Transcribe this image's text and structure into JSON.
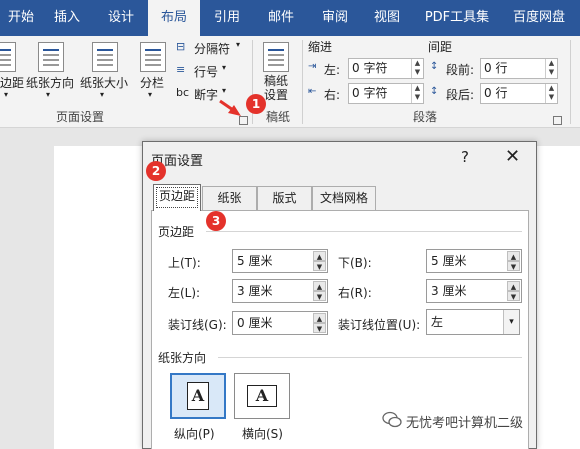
{
  "ribbon_tabs": [
    "开始",
    "插入",
    "设计",
    "布局",
    "引用",
    "邮件",
    "审阅",
    "视图",
    "PDF工具集",
    "百度网盘"
  ],
  "active_tab": "布局",
  "ribbon": {
    "margins_label": "边距",
    "orientation_label": "纸张方向",
    "size_label": "纸张大小",
    "columns_label": "分栏",
    "breaks_label": "分隔符",
    "line_numbers_label": "行号",
    "hyphenation_label": "断字",
    "page_setup_group": "页面设置",
    "draft_paper_label": "稿纸设置",
    "draft_paper_group": "稿纸",
    "indent_label": "缩进",
    "spacing_label": "间距",
    "indent_left_label": "左:",
    "indent_left_value": "0 字符",
    "indent_right_label": "右:",
    "indent_right_value": "0 字符",
    "spacing_before_label": "段前:",
    "spacing_before_value": "0 行",
    "spacing_after_label": "段后:",
    "spacing_after_value": "0 行",
    "paragraph_group": "段落"
  },
  "dialog": {
    "title": "页面设置",
    "help": "?",
    "close": "✕",
    "tabs": [
      "页边距",
      "纸张",
      "版式",
      "文档网格"
    ],
    "margins_section": "页边距",
    "top_label": "上(T):",
    "top_value": "5 厘米",
    "bottom_label": "下(B):",
    "bottom_value": "5 厘米",
    "left_label": "左(L):",
    "left_value": "3 厘米",
    "right_label": "右(R):",
    "right_value": "3 厘米",
    "gutter_label": "装订线(G):",
    "gutter_value": "0 厘米",
    "gutter_pos_label": "装订线位置(U):",
    "gutter_pos_value": "左",
    "orientation_section": "纸张方向",
    "portrait_label": "纵向(P)",
    "landscape_label": "横向(S)",
    "paper_glyph": "A"
  },
  "badges": [
    "1",
    "2",
    "3"
  ],
  "watermark": "无忧考吧计算机二级",
  "colors": {
    "accent": "#2b579a",
    "badge": "#e4322b",
    "arrow": "#e4322b"
  }
}
